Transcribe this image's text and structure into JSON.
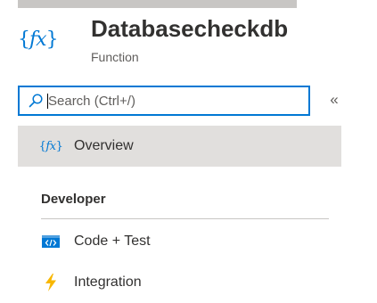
{
  "header": {
    "icon": "function-fx-icon",
    "title": "Databasecheckdb",
    "subtitle": "Function"
  },
  "search": {
    "placeholder": "Search (Ctrl+/)",
    "value": ""
  },
  "collapse_label": "«",
  "nav": {
    "items": [
      {
        "label": "Overview",
        "icon": "function-fx-icon",
        "selected": true
      }
    ],
    "sections": [
      {
        "title": "Developer",
        "items": [
          {
            "label": "Code + Test",
            "icon": "code-icon"
          },
          {
            "label": "Integration",
            "icon": "lightning-icon"
          }
        ]
      }
    ]
  },
  "colors": {
    "accent": "#0078d4",
    "selected_bg": "#e1dfdd",
    "lightning": "#f8b700"
  }
}
